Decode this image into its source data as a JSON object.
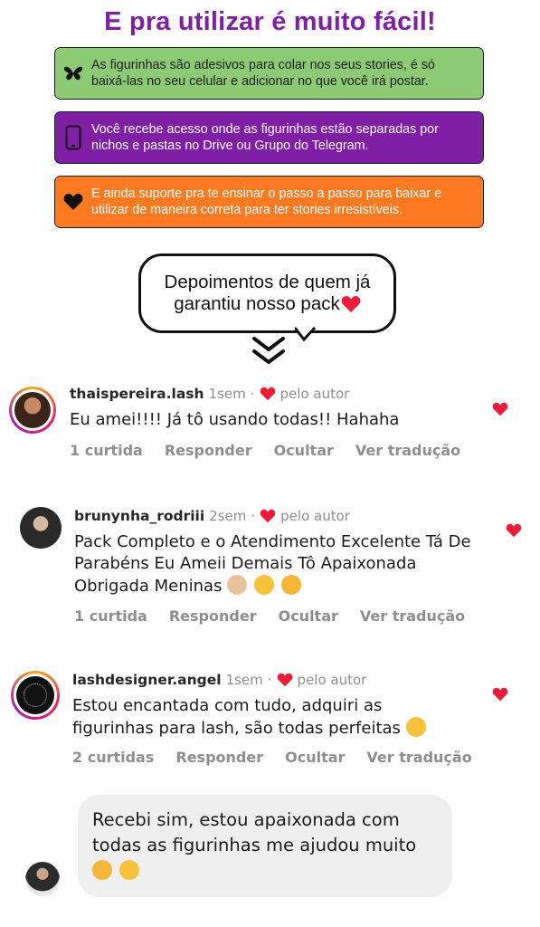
{
  "title": "E pra utilizar é muito fácil!",
  "cards": [
    {
      "icon": "butterfly-icon",
      "text": "As figurinhas são adesivos para colar nos seus  stories, é só baixá-las no seu celular e adicionar no que você irá postar.",
      "color": "#8ccb74"
    },
    {
      "icon": "phone-icon",
      "text": "Você recebe acesso onde as figurinhas estão separadas por nichos e pastas no Drive ou Grupo do Telegram.",
      "color": "#7e1fa5"
    },
    {
      "icon": "heart-icon",
      "text": "E ainda suporte pra te ensinar o passo a passo para baixar e utilizar de maneira correta para ter stories irresistíveis.",
      "color": "#ff7a21"
    }
  ],
  "testimonial_bubble": {
    "line1": "Depoimentos de quem já",
    "line2": "garantiu nosso pack"
  },
  "comments": [
    {
      "username": "thaispereira.lash",
      "time": "1sem",
      "author_label": "pelo autor",
      "text": "Eu amei!!!! Já tô usando todas!! Hahaha",
      "likes": "1 curtida",
      "reply": "Responder",
      "hide": "Ocultar",
      "translate": "Ver tradução"
    },
    {
      "username": "brunynha_rodriii",
      "time": "2sem",
      "author_label": "pelo autor",
      "text": "Pack Completo e o Atendimento Excelente Tá De Parabéns Eu Ameii Demais Tô Apaixonada Obrigada Meninas",
      "likes": "1 curtida",
      "reply": "Responder",
      "hide": "Ocultar",
      "translate": "Ver tradução"
    },
    {
      "username": "lashdesigner.angel",
      "time": "1sem",
      "author_label": "pelo autor",
      "text": "Estou encantada com tudo, adquiri as figurinhas para lash, são todas perfeitas",
      "likes": "2 curtidas",
      "reply": "Responder",
      "hide": "Ocultar",
      "translate": "Ver tradução"
    }
  ],
  "reply_message": {
    "text": "Recebi sim, estou apaixonada com todas as figurinhas me ajudou muito"
  },
  "colors": {
    "purple": "#7e1fa5",
    "green": "#8ccb74",
    "orange": "#ff7a21",
    "heart_red": "#ed1c3a",
    "meta_gray": "#8e8e8e"
  }
}
